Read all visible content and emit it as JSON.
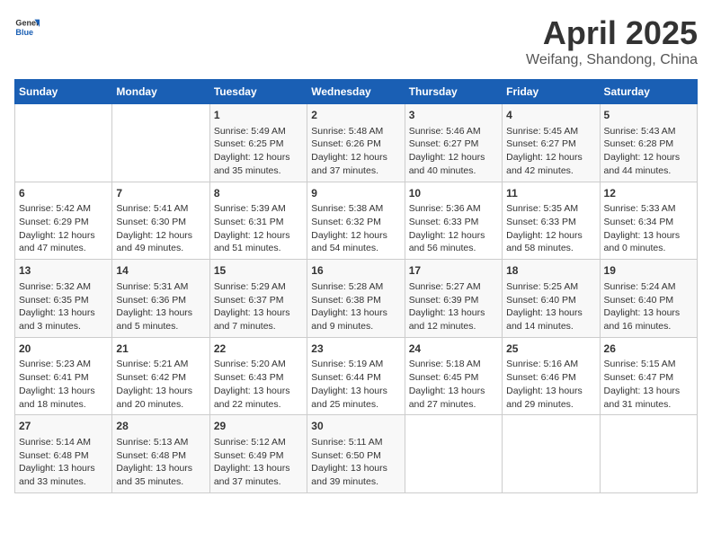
{
  "logo": {
    "general": "General",
    "blue": "Blue"
  },
  "title": "April 2025",
  "subtitle": "Weifang, Shandong, China",
  "days_of_week": [
    "Sunday",
    "Monday",
    "Tuesday",
    "Wednesday",
    "Thursday",
    "Friday",
    "Saturday"
  ],
  "weeks": [
    [
      {
        "day": "",
        "info": ""
      },
      {
        "day": "",
        "info": ""
      },
      {
        "day": "1",
        "info": "Sunrise: 5:49 AM\nSunset: 6:25 PM\nDaylight: 12 hours\nand 35 minutes."
      },
      {
        "day": "2",
        "info": "Sunrise: 5:48 AM\nSunset: 6:26 PM\nDaylight: 12 hours\nand 37 minutes."
      },
      {
        "day": "3",
        "info": "Sunrise: 5:46 AM\nSunset: 6:27 PM\nDaylight: 12 hours\nand 40 minutes."
      },
      {
        "day": "4",
        "info": "Sunrise: 5:45 AM\nSunset: 6:27 PM\nDaylight: 12 hours\nand 42 minutes."
      },
      {
        "day": "5",
        "info": "Sunrise: 5:43 AM\nSunset: 6:28 PM\nDaylight: 12 hours\nand 44 minutes."
      }
    ],
    [
      {
        "day": "6",
        "info": "Sunrise: 5:42 AM\nSunset: 6:29 PM\nDaylight: 12 hours\nand 47 minutes."
      },
      {
        "day": "7",
        "info": "Sunrise: 5:41 AM\nSunset: 6:30 PM\nDaylight: 12 hours\nand 49 minutes."
      },
      {
        "day": "8",
        "info": "Sunrise: 5:39 AM\nSunset: 6:31 PM\nDaylight: 12 hours\nand 51 minutes."
      },
      {
        "day": "9",
        "info": "Sunrise: 5:38 AM\nSunset: 6:32 PM\nDaylight: 12 hours\nand 54 minutes."
      },
      {
        "day": "10",
        "info": "Sunrise: 5:36 AM\nSunset: 6:33 PM\nDaylight: 12 hours\nand 56 minutes."
      },
      {
        "day": "11",
        "info": "Sunrise: 5:35 AM\nSunset: 6:33 PM\nDaylight: 12 hours\nand 58 minutes."
      },
      {
        "day": "12",
        "info": "Sunrise: 5:33 AM\nSunset: 6:34 PM\nDaylight: 13 hours\nand 0 minutes."
      }
    ],
    [
      {
        "day": "13",
        "info": "Sunrise: 5:32 AM\nSunset: 6:35 PM\nDaylight: 13 hours\nand 3 minutes."
      },
      {
        "day": "14",
        "info": "Sunrise: 5:31 AM\nSunset: 6:36 PM\nDaylight: 13 hours\nand 5 minutes."
      },
      {
        "day": "15",
        "info": "Sunrise: 5:29 AM\nSunset: 6:37 PM\nDaylight: 13 hours\nand 7 minutes."
      },
      {
        "day": "16",
        "info": "Sunrise: 5:28 AM\nSunset: 6:38 PM\nDaylight: 13 hours\nand 9 minutes."
      },
      {
        "day": "17",
        "info": "Sunrise: 5:27 AM\nSunset: 6:39 PM\nDaylight: 13 hours\nand 12 minutes."
      },
      {
        "day": "18",
        "info": "Sunrise: 5:25 AM\nSunset: 6:40 PM\nDaylight: 13 hours\nand 14 minutes."
      },
      {
        "day": "19",
        "info": "Sunrise: 5:24 AM\nSunset: 6:40 PM\nDaylight: 13 hours\nand 16 minutes."
      }
    ],
    [
      {
        "day": "20",
        "info": "Sunrise: 5:23 AM\nSunset: 6:41 PM\nDaylight: 13 hours\nand 18 minutes."
      },
      {
        "day": "21",
        "info": "Sunrise: 5:21 AM\nSunset: 6:42 PM\nDaylight: 13 hours\nand 20 minutes."
      },
      {
        "day": "22",
        "info": "Sunrise: 5:20 AM\nSunset: 6:43 PM\nDaylight: 13 hours\nand 22 minutes."
      },
      {
        "day": "23",
        "info": "Sunrise: 5:19 AM\nSunset: 6:44 PM\nDaylight: 13 hours\nand 25 minutes."
      },
      {
        "day": "24",
        "info": "Sunrise: 5:18 AM\nSunset: 6:45 PM\nDaylight: 13 hours\nand 27 minutes."
      },
      {
        "day": "25",
        "info": "Sunrise: 5:16 AM\nSunset: 6:46 PM\nDaylight: 13 hours\nand 29 minutes."
      },
      {
        "day": "26",
        "info": "Sunrise: 5:15 AM\nSunset: 6:47 PM\nDaylight: 13 hours\nand 31 minutes."
      }
    ],
    [
      {
        "day": "27",
        "info": "Sunrise: 5:14 AM\nSunset: 6:48 PM\nDaylight: 13 hours\nand 33 minutes."
      },
      {
        "day": "28",
        "info": "Sunrise: 5:13 AM\nSunset: 6:48 PM\nDaylight: 13 hours\nand 35 minutes."
      },
      {
        "day": "29",
        "info": "Sunrise: 5:12 AM\nSunset: 6:49 PM\nDaylight: 13 hours\nand 37 minutes."
      },
      {
        "day": "30",
        "info": "Sunrise: 5:11 AM\nSunset: 6:50 PM\nDaylight: 13 hours\nand 39 minutes."
      },
      {
        "day": "",
        "info": ""
      },
      {
        "day": "",
        "info": ""
      },
      {
        "day": "",
        "info": ""
      }
    ]
  ]
}
